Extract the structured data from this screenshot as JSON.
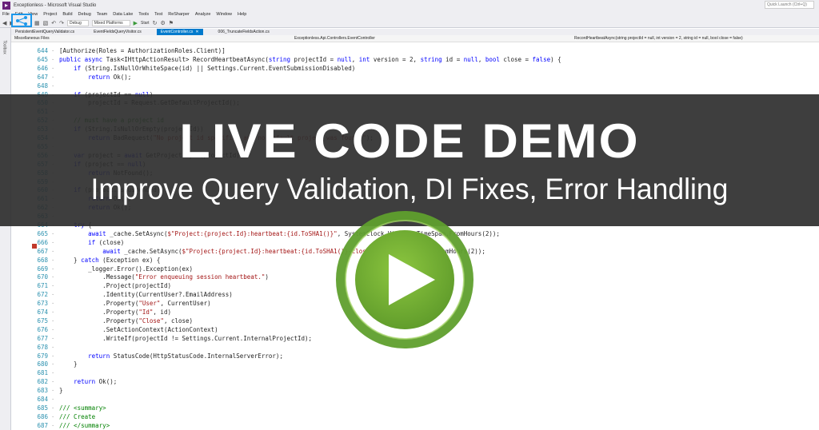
{
  "window": {
    "title": "Exceptionless - Microsoft Visual Studio",
    "quick_launch_placeholder": "Quick Launch (Ctrl+Q)"
  },
  "menu": [
    "File",
    "Edit",
    "View",
    "Project",
    "Build",
    "Debug",
    "Team",
    "Data Lake",
    "Tools",
    "Test",
    "ReSharper",
    "Analyze",
    "Window",
    "Help"
  ],
  "toolbar": {
    "config": "Debug",
    "platform": "Mixed Platforms",
    "start": "Start"
  },
  "tabs": [
    {
      "label": "PersistentEventQueryValidator.cs",
      "active": false
    },
    {
      "label": "EventFieldsQueryVisitor.cs",
      "active": false
    },
    {
      "label": "EventController.cs",
      "active": true
    },
    {
      "label": "006_TruncateFieldsAction.cs",
      "active": false
    }
  ],
  "side_toolbox": "Toolbox",
  "navbar": {
    "project": "Miscellaneous Files",
    "class": "Exceptionless.Api.Controllers.EventController",
    "member": "RecordHeartbeatAsync(string projectId = null, int version = 2, string id = null, bool close = false)"
  },
  "code_lines": [
    {
      "n": "644",
      "text": "[Authorize(Roles = AuthorizationRoles.Client)]"
    },
    {
      "n": "645",
      "text": "public async Task<IHttpActionResult> RecordHeartbeatAsync(string projectId = null, int version = 2, string id = null, bool close = false) {"
    },
    {
      "n": "646",
      "text": "    if (String.IsNullOrWhiteSpace(id) || Settings.Current.EventSubmissionDisabled)"
    },
    {
      "n": "647",
      "text": "        return Ok();"
    },
    {
      "n": "648",
      "text": ""
    },
    {
      "n": "649",
      "text": "    if (projectId == null)"
    },
    {
      "n": "650",
      "text": "        projectId = Request.GetDefaultProjectId();"
    },
    {
      "n": "651",
      "text": ""
    },
    {
      "n": "652",
      "text": "    // must have a project id"
    },
    {
      "n": "653",
      "text": "    if (String.IsNullOrEmpty(projectId))"
    },
    {
      "n": "654",
      "text": "        return BadRequest(\"No project id specified and no default project was found.\");"
    },
    {
      "n": "655",
      "text": ""
    },
    {
      "n": "656",
      "text": "    var project = await GetProjectAsync(projectId);"
    },
    {
      "n": "657",
      "text": "    if (project == null)"
    },
    {
      "n": "658",
      "text": "        return NotFound();"
    },
    {
      "n": "659",
      "text": ""
    },
    {
      "n": "660",
      "text": "    if (project.IsSuspended)"
    },
    {
      "n": "661",
      "text": "        return Ok();"
    },
    {
      "n": "662",
      "text": "        return Ok();"
    },
    {
      "n": "663",
      "text": ""
    },
    {
      "n": "664",
      "text": "    try {"
    },
    {
      "n": "665",
      "text": "        await _cache.SetAsync($\"Project:{project.Id}:heartbeat:{id.ToSHA1()}\", SystemClock.UtcNow, TimeSpan.FromHours(2));"
    },
    {
      "n": "666",
      "text": "        if (close)"
    },
    {
      "n": "667",
      "text": "            await _cache.SetAsync($\"Project:{project.Id}:heartbeat:{id.ToSHA1()}-close\", true, TimeSpan.FromHours(2));"
    },
    {
      "n": "668",
      "text": "    } catch (Exception ex) {"
    },
    {
      "n": "669",
      "text": "        _logger.Error().Exception(ex)"
    },
    {
      "n": "670",
      "text": "            .Message(\"Error enqueuing session heartbeat.\")"
    },
    {
      "n": "671",
      "text": "            .Project(projectId)"
    },
    {
      "n": "672",
      "text": "            .Identity(CurrentUser?.EmailAddress)"
    },
    {
      "n": "673",
      "text": "            .Property(\"User\", CurrentUser)"
    },
    {
      "n": "674",
      "text": "            .Property(\"Id\", id)"
    },
    {
      "n": "675",
      "text": "            .Property(\"Close\", close)"
    },
    {
      "n": "676",
      "text": "            .SetActionContext(ActionContext)"
    },
    {
      "n": "677",
      "text": "            .WriteIf(projectId != Settings.Current.InternalProjectId);"
    },
    {
      "n": "678",
      "text": ""
    },
    {
      "n": "679",
      "text": "        return StatusCode(HttpStatusCode.InternalServerError);"
    },
    {
      "n": "680",
      "text": "    }"
    },
    {
      "n": "681",
      "text": ""
    },
    {
      "n": "682",
      "text": "    return Ok();"
    },
    {
      "n": "683",
      "text": "}"
    },
    {
      "n": "684",
      "text": ""
    },
    {
      "n": "685",
      "text": "/// <summary>"
    },
    {
      "n": "686",
      "text": "/// Create"
    },
    {
      "n": "687",
      "text": "/// </summary>"
    },
    {
      "n": "688",
      "text": "/// <remarks>"
    }
  ],
  "banner": {
    "title": "LIVE CODE DEMO",
    "subtitle": "Improve Query Validation, DI Fixes, Error Handling"
  },
  "colors": {
    "accent": "#007acc",
    "play_green": "#7ab83a",
    "banner_bg": "#2e2e2e"
  }
}
